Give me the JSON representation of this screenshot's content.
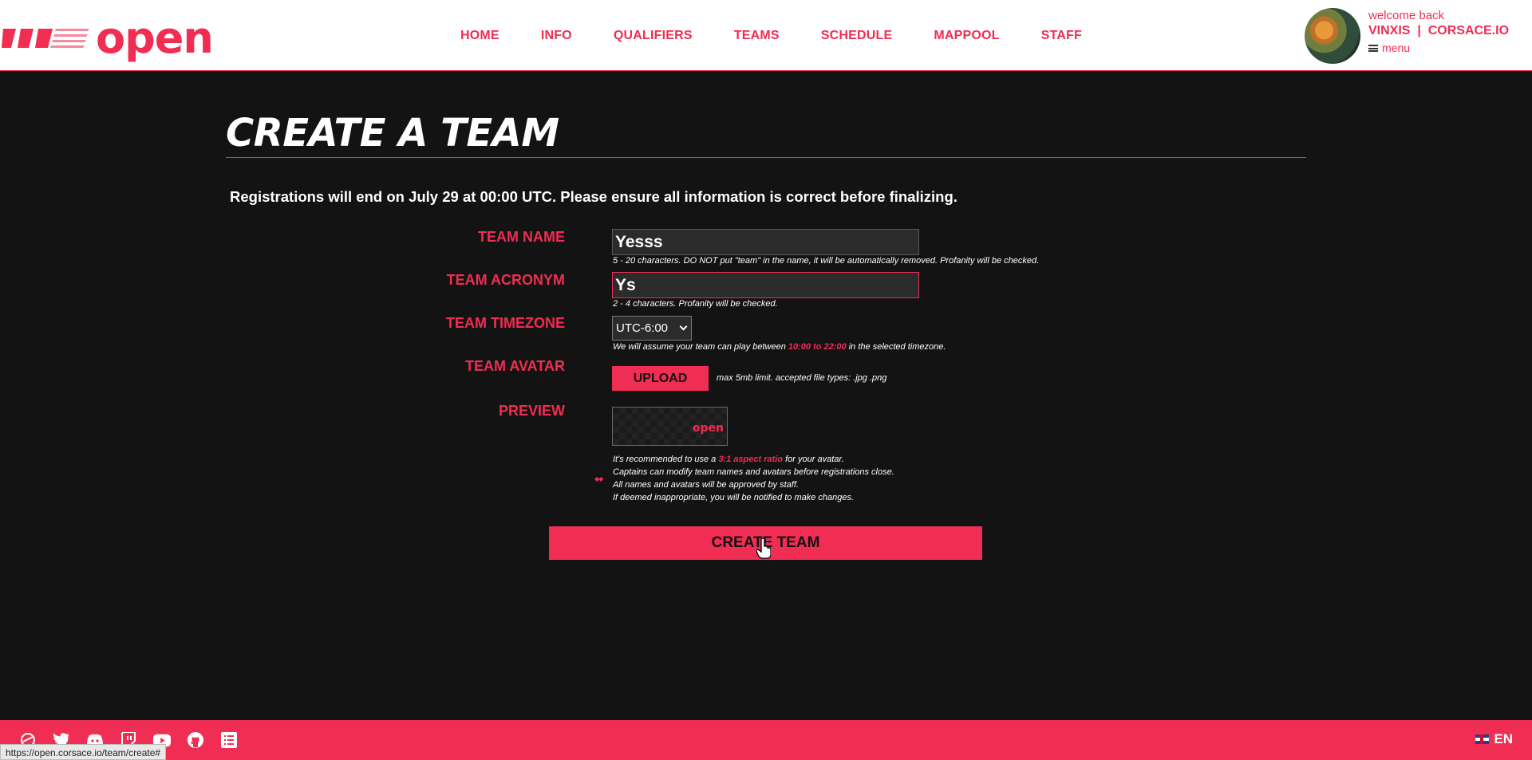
{
  "header": {
    "logo_text": "open",
    "nav": [
      "HOME",
      "INFO",
      "QUALIFIERS",
      "TEAMS",
      "SCHEDULE",
      "MAPPOOL",
      "STAFF"
    ],
    "welcome": "welcome back",
    "username": "VINXIS  |  CORSACE.IO",
    "menu_label": "menu"
  },
  "page": {
    "title": "CREATE A TEAM",
    "notice": "Registrations will end on July 29 at 00:00 UTC. Please ensure all information is correct before finalizing."
  },
  "form": {
    "team_name_label": "TEAM NAME",
    "team_name_value": "Yesss",
    "team_name_hint": "5 - 20 characters. DO NOT put \"team\" in the name, it will be automatically removed. Profanity will be checked.",
    "team_acronym_label": "TEAM ACRONYM",
    "team_acronym_value": "Ys",
    "team_acronym_hint": "2 - 4 characters. Profanity will be checked.",
    "team_timezone_label": "TEAM TIMEZONE",
    "team_timezone_value": "UTC-6:00",
    "timezone_hint_pre": "We will assume your team can play between",
    "timezone_hint_range": "10:00 to 22:00",
    "timezone_hint_post": "in the selected timezone.",
    "team_avatar_label": "TEAM AVATAR",
    "upload_label": "UPLOAD",
    "upload_hint": "max 5mb limit. accepted file types: .jpg .png",
    "preview_label": "PREVIEW",
    "preview_logo": "open",
    "note1_pre": "It's recommended to use a",
    "note1_hl": "3:1 aspect ratio",
    "note1_post": "for your avatar.",
    "note2": "Captains can modify team names and avatars before registrations close.",
    "note3": "All names and avatars will be approved by staff.",
    "note4": "If deemed inappropriate, you will be notified to make changes.",
    "create_button": "CREATE TEAM"
  },
  "footer": {
    "social_icons": [
      "osu-icon",
      "twitter-icon",
      "discord-icon",
      "twitch-icon",
      "youtube-icon",
      "github-icon",
      "list-icon"
    ],
    "language": "EN",
    "status_url": "https://open.corsace.io/team/create#"
  },
  "colors": {
    "accent": "#f02d53",
    "background": "#131313",
    "header_bg": "#ffffff"
  }
}
